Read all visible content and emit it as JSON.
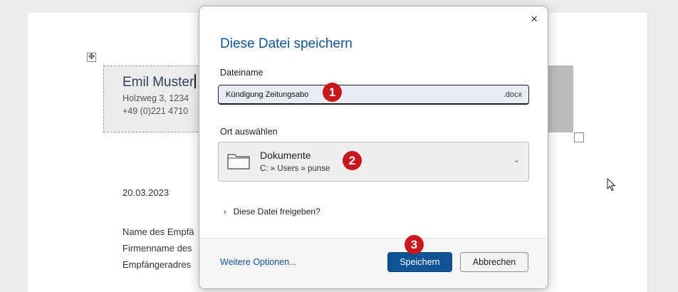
{
  "document": {
    "sender_name": "Emil Muster",
    "sender_street": "Holzweg 3, 1234",
    "sender_phone": "+49 (0)221 4710",
    "date": "20.03.2023",
    "recipient_name": "Name des Empfä",
    "recipient_company": "Firmenname des",
    "recipient_address": "Empfängeradres"
  },
  "dialog": {
    "title": "Diese Datei speichern",
    "close_label": "×",
    "filename_label": "Dateiname",
    "filename_value": "Kündigung Zeitungsabo",
    "filename_extension": ".docx",
    "location_label": "Ort auswählen",
    "location_name": "Dokumente",
    "location_path": "C: » Users » punse",
    "share_arrow": "›",
    "share_label": "Diese Datei freigeben?",
    "more_options": "Weitere Optionen...",
    "save_button": "Speichern",
    "cancel_button": "Abbrechen"
  },
  "badges": {
    "step1": "1",
    "step2": "2",
    "step3": "3"
  },
  "colors": {
    "accent": "#0f5396",
    "badge": "#c9171e"
  },
  "icons": {
    "move": "move-handle-icon",
    "folder": "folder-icon",
    "chevron": "chevron-down-icon",
    "cursor": "mouse-pointer-icon"
  }
}
